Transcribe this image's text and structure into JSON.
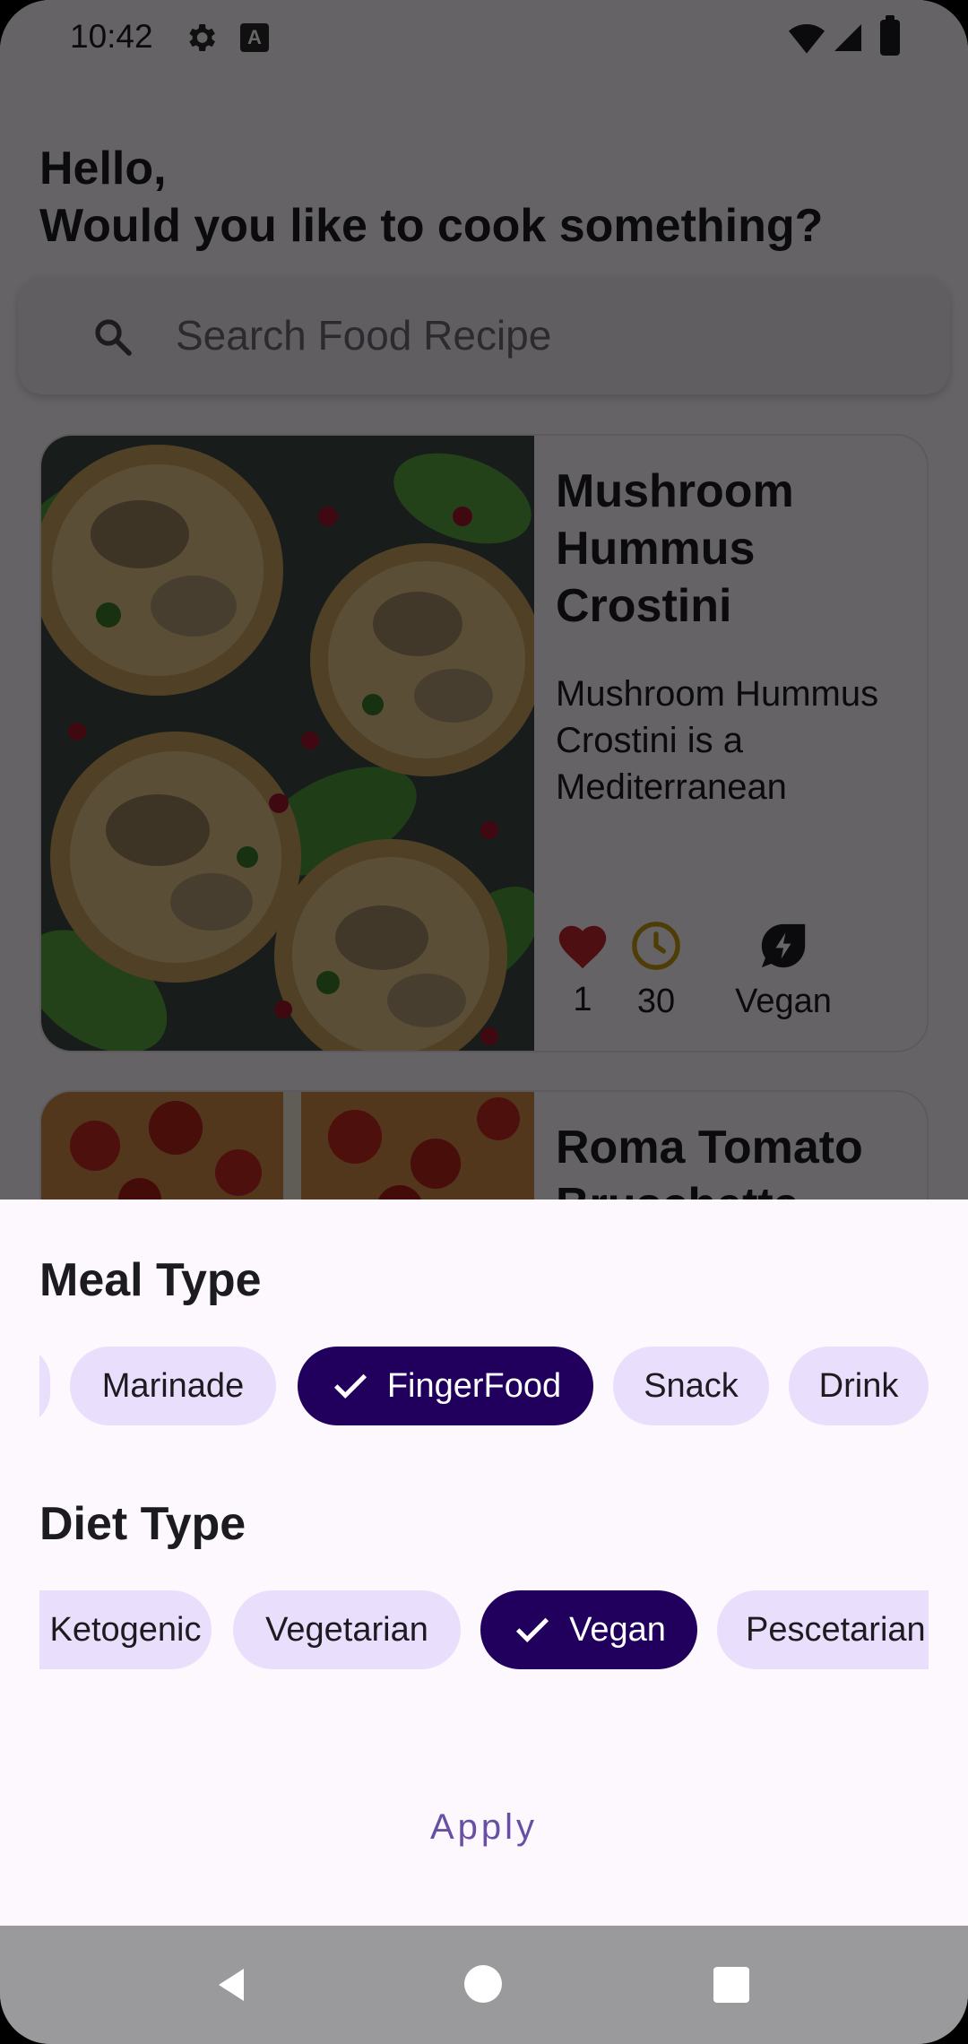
{
  "status_bar": {
    "time": "10:42",
    "icons": [
      "gear-icon",
      "a-icon",
      "wifi-icon",
      "signal-icon",
      "battery-icon"
    ]
  },
  "greeting": {
    "line1": "Hello,",
    "line2": "Would you like to cook something?"
  },
  "search": {
    "placeholder": "Search Food Recipe",
    "icon": "search-icon"
  },
  "recipes": [
    {
      "title": "Mushroom Hummus Crostini",
      "description": "Mushroom Hummus Crostini is a Mediterranean",
      "likes": "1",
      "minutes": "30",
      "diet": "Vegan"
    },
    {
      "title": "Roma Tomato Bruschetta"
    }
  ],
  "meal_type": {
    "title": "Meal Type",
    "chips": [
      {
        "label": "Marinade",
        "selected": false
      },
      {
        "label": "FingerFood",
        "selected": true
      },
      {
        "label": "Snack",
        "selected": false
      },
      {
        "label": "Drink",
        "selected": false
      }
    ]
  },
  "diet_type": {
    "title": "Diet Type",
    "chips": [
      {
        "label": "Ketogenic",
        "selected": false
      },
      {
        "label": "Vegetarian",
        "selected": false
      },
      {
        "label": "Vegan",
        "selected": true
      },
      {
        "label": "Pescetarian",
        "selected": false
      }
    ]
  },
  "apply_label": "Apply",
  "colors": {
    "accent": "#6750a4",
    "chip": "#e9defc",
    "chip_selected": "#21005d",
    "heart": "#c3262e",
    "clock": "#c49a12"
  }
}
